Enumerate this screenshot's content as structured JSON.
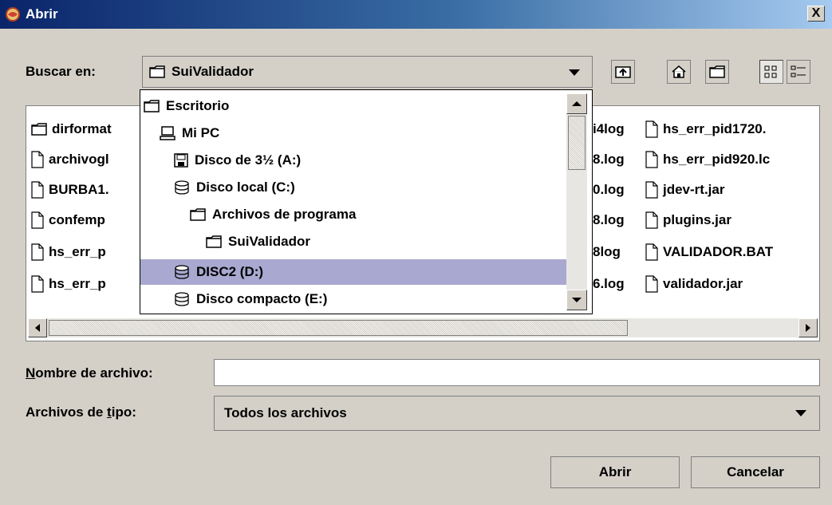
{
  "window": {
    "title": "Abrir",
    "close_label": "X"
  },
  "look_in": {
    "label": "Buscar en:",
    "value": "SuiValidador"
  },
  "toolbar": {
    "icons": [
      "up-folder-icon",
      "home-icon",
      "new-folder-icon",
      "list-view-icon",
      "details-view-icon"
    ]
  },
  "dropdown": {
    "items": [
      {
        "label": "Escritorio",
        "icon": "folder-icon"
      },
      {
        "label": "Mi PC",
        "icon": "computer-icon"
      },
      {
        "label": "Disco de 3½ (A:)",
        "icon": "floppy-icon"
      },
      {
        "label": "Disco local (C:)",
        "icon": "drive-icon"
      },
      {
        "label": "Archivos de programa",
        "icon": "folder-icon"
      },
      {
        "label": "SuiValidador",
        "icon": "folder-icon"
      },
      {
        "label": "DISC2 (D:)",
        "icon": "drive-icon",
        "selected": true
      },
      {
        "label": "Disco compacto (E:)",
        "icon": "drive-icon"
      }
    ]
  },
  "files": {
    "col1": [
      "dirformat",
      "archivogl",
      "BURBA1.",
      "confemp",
      "hs_err_p",
      "hs_err_p"
    ],
    "col2": [
      "i4log",
      "8.log",
      "0.log",
      "8.log",
      "8log",
      "6.log"
    ],
    "col3": [
      "hs_err_pid1720.",
      "hs_err_pid920.lc",
      "jdev-rt.jar",
      "plugins.jar",
      "VALIDADOR.BAT",
      "validador.jar"
    ]
  },
  "filename": {
    "label_u": "N",
    "label_rest": "ombre de archivo:",
    "value": ""
  },
  "filetype": {
    "label_pre": "Archivos de ",
    "label_u": "t",
    "label_post": "ipo:",
    "value": "Todos los archivos"
  },
  "buttons": {
    "open": "Abrir",
    "cancel": "Cancelar"
  }
}
